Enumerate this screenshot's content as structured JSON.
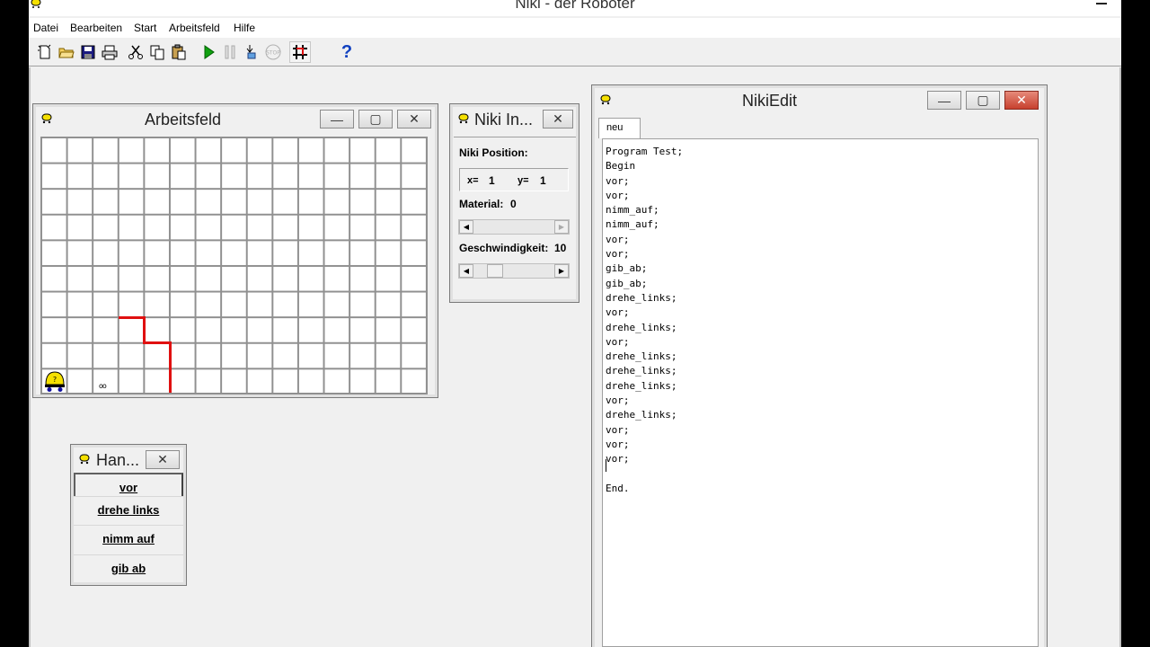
{
  "app": {
    "title": "Niki - der Roboter"
  },
  "menu": [
    "Datei",
    "Bearbeiten",
    "Start",
    "Arbeitsfeld",
    "Hilfe"
  ],
  "toolbar": {
    "icons": [
      "new-document-icon",
      "open-folder-icon",
      "save-disk-icon",
      "print-icon",
      "cut-scissors-icon",
      "copy-icon",
      "paste-icon",
      "run-play-icon",
      "pause-icon",
      "step-icon",
      "stop-icon",
      "grid-toggle-icon",
      "help-question-icon"
    ],
    "help_label": "?"
  },
  "arbeitsfeld": {
    "title": "Arbeitsfeld",
    "columns": 15,
    "rows": 10,
    "items_marker": "oo"
  },
  "info": {
    "title": "Niki In...",
    "position_label": "Niki Position:",
    "x_label": "x=",
    "x_value": "1",
    "y_label": "y=",
    "y_value": "1",
    "material_label": "Material:",
    "material_value": "0",
    "speed_label": "Geschwindigkeit:",
    "speed_value": "10"
  },
  "hand": {
    "title": "Han...",
    "buttons": [
      "vor",
      "drehe links",
      "nimm auf",
      "gib ab"
    ]
  },
  "editor": {
    "title": "NikiEdit",
    "tab": "neu",
    "code": "Program Test;\nBegin\nvor;\nvor;\nnimm_auf;\nnimm_auf;\nvor;\nvor;\ngib_ab;\ngib_ab;\ndrehe_links;\nvor;\ndrehe_links;\nvor;\ndrehe_links;\ndrehe_links;\ndrehe_links;\nvor;\ndrehe_links;\nvor;\nvor;\nvor;\n\nEnd."
  },
  "colors": {
    "path_red": "#e01010",
    "robot_yellow": "#f5e000",
    "close_red": "#c7402e"
  }
}
